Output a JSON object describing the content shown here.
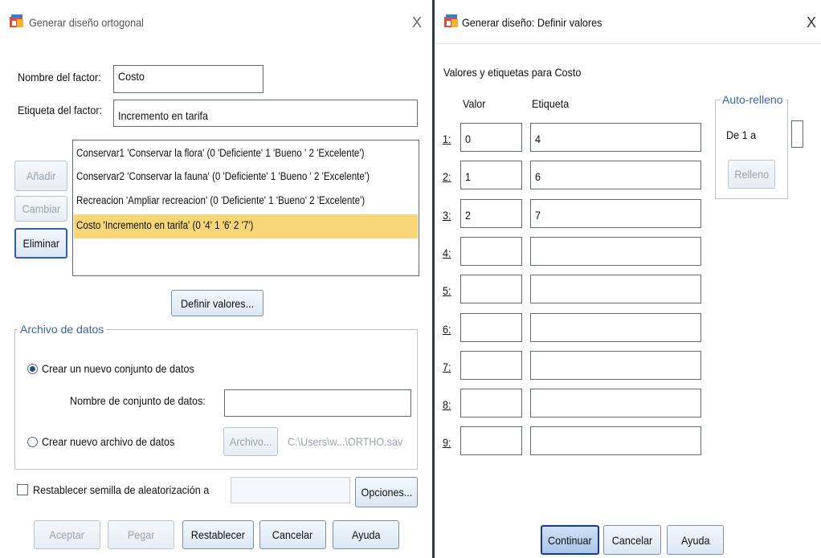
{
  "left_dialog": {
    "title": "Generar diseño ortogonal",
    "close": "X",
    "factor_name_label": "Nombre del factor:",
    "factor_name_value": "Costo",
    "factor_label_label": "Etiqueta del factor:",
    "factor_label_value": "Incremento  en tarifa",
    "factors": [
      "Conservar1 'Conservar la flora' (0 'Deficiente' 1 'Bueno ' 2 'Excelente')",
      "Conservar2 'Conservar la fauna' (0 'Deficiente' 1 'Bueno ' 2 'Excelente')",
      "Recreacion 'Ampliar recreacion' (0 'Deficiente' 1 'Bueno' 2 'Excelente')",
      "Costo 'Incremento  en tarifa' (0 '4' 1 '6' 2 '7')"
    ],
    "selected_index": 3,
    "add_label": "Añadir",
    "change_label": "Cambiar",
    "remove_label": "Eliminar",
    "define_values_label": "Definir valores...",
    "data_file_group": "Archivo de datos",
    "radio_new_dataset": "Crear un nuevo conjunto de datos",
    "dataset_name_label": "Nombre de conjunto de datos:",
    "dataset_name_value": "",
    "radio_new_file": "Crear nuevo archivo de datos",
    "file_button": "Archivo...",
    "file_path": "C:\\Users\\w...\\ORTHO.sav",
    "reset_seed_label": "Restablecer semilla de aleatorización a",
    "seed_value": "",
    "options_label": "Opciones...",
    "ok_label": "Aceptar",
    "paste_label": "Pegar",
    "reset_label": "Restablecer",
    "cancel_label": "Cancelar",
    "help_label": "Ayuda"
  },
  "right_dialog": {
    "title": "Generar diseño: Definir valores",
    "close": "X",
    "section_title": "Valores y etiquetas para Costo",
    "col_value": "Valor",
    "col_label": "Etiqueta",
    "rows": [
      {
        "n": "1:",
        "value": "0",
        "label": "4"
      },
      {
        "n": "2:",
        "value": "1",
        "label": "6"
      },
      {
        "n": "3:",
        "value": "2",
        "label": "7"
      },
      {
        "n": "4:",
        "value": "",
        "label": ""
      },
      {
        "n": "5:",
        "value": "",
        "label": ""
      },
      {
        "n": "6:",
        "value": "",
        "label": ""
      },
      {
        "n": "7:",
        "value": "",
        "label": ""
      },
      {
        "n": "8:",
        "value": "",
        "label": ""
      },
      {
        "n": "9:",
        "value": "",
        "label": ""
      }
    ],
    "autofill_group": "Auto-relleno",
    "autofill_from": "De 1 a",
    "autofill_to_value": "",
    "fill_label": "Relleno",
    "continue_label": "Continuar",
    "cancel_label": "Cancelar",
    "help_label": "Ayuda"
  },
  "colors": {
    "selection": "#f8d577",
    "group_label": "#3a63a8",
    "disabled_text": "#9aa3ad",
    "divider": "#2a3950"
  },
  "icons": {
    "app_icon": "spss-dialog-icon",
    "close_icon": "close-icon",
    "radio_icon": "radio-button",
    "checkbox_icon": "checkbox"
  }
}
